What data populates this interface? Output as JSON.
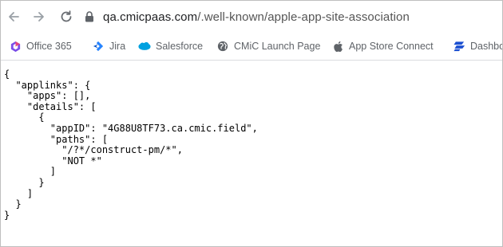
{
  "browser": {
    "url_host": "qa.cmicpaas.com",
    "url_path": "/.well-known/apple-app-site-association"
  },
  "bookmarks": [
    {
      "label": "Office 365",
      "icon": "office365-icon"
    },
    {
      "label": "Jira",
      "icon": "jira-icon"
    },
    {
      "label": "Salesforce",
      "icon": "salesforce-icon"
    },
    {
      "label": "CMiC Launch Page",
      "icon": "globe-icon"
    },
    {
      "label": "App Store Connect",
      "icon": "apple-icon"
    },
    {
      "label": "Dashbo",
      "icon": "dashboard-icon"
    }
  ],
  "colors": {
    "office365": "#7b4ee8",
    "jira": "#2684ff",
    "salesforce": "#00a1e0",
    "dashboard": "#1b4fd1"
  },
  "content": {
    "json_text": "{\n  \"applinks\": {\n    \"apps\": [],\n    \"details\": [\n      {\n        \"appID\": \"4G88U8TF73.ca.cmic.field\",\n        \"paths\": [\n          \"/?*/construct-pm/*\",\n          \"NOT *\"\n        ]\n      }\n    ]\n  }\n}"
  }
}
